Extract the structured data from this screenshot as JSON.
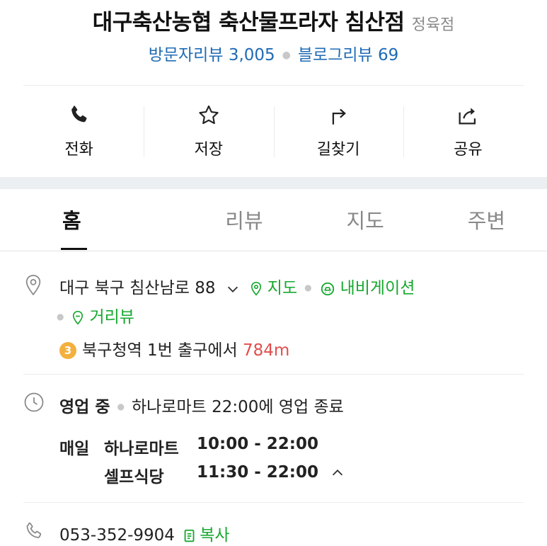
{
  "place": {
    "name": "대구축산농협 축산물프라자 침산점",
    "category": "정육점",
    "visitor_reviews": "방문자리뷰 3,005",
    "blog_reviews": "블로그리뷰 69"
  },
  "actions": [
    {
      "label": "전화",
      "icon": "phone-icon"
    },
    {
      "label": "저장",
      "icon": "star-icon"
    },
    {
      "label": "길찾기",
      "icon": "directions-icon"
    },
    {
      "label": "공유",
      "icon": "share-icon"
    }
  ],
  "tabs": [
    {
      "label": "홈",
      "active": true
    },
    {
      "label": "리뷰",
      "active": false
    },
    {
      "label": "지도",
      "active": false
    },
    {
      "label": "주변",
      "active": false
    }
  ],
  "address": {
    "text": "대구 북구 침산남로 88",
    "map_link": "지도",
    "navi_link": "내비게이션",
    "street_view_link": "거리뷰"
  },
  "subway": {
    "line_number": "3",
    "station": "북구청역",
    "exit_text": "1번 출구에서",
    "distance": "784m"
  },
  "hours": {
    "status": "영업 중",
    "summary": "하나로마트 22:00에 영업 종료",
    "day": "매일",
    "rows": [
      {
        "name": "하나로마트",
        "time": "10:00 - 22:00"
      },
      {
        "name": "셀프식당",
        "time": "11:30 - 22:00"
      }
    ]
  },
  "phone": {
    "number": "053-352-9904",
    "copy_label": "복사"
  },
  "colors": {
    "link_blue": "#1f6bb5",
    "green": "#17a82f",
    "distance_red": "#e24e4e",
    "badge_line3": "#f3b03e"
  }
}
